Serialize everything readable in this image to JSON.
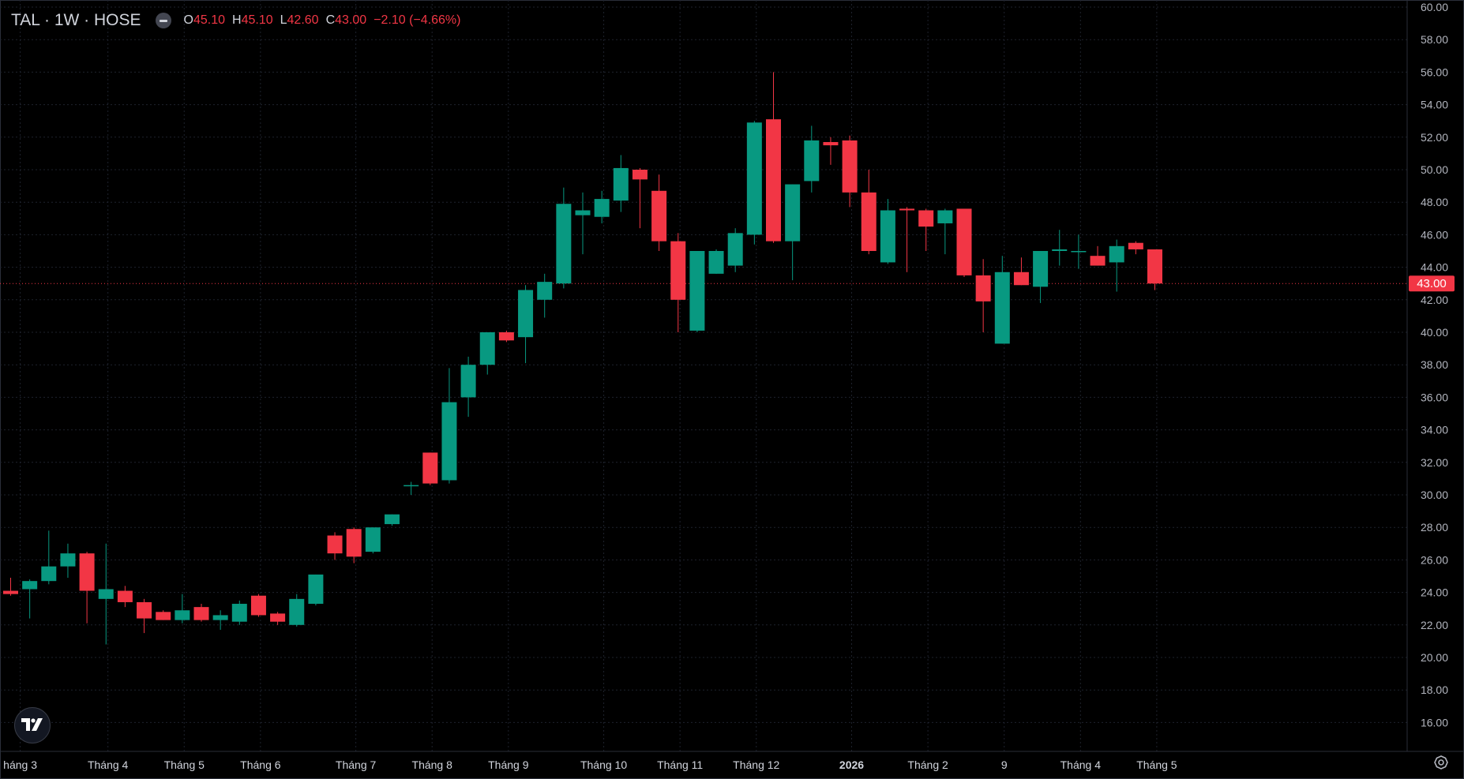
{
  "header": {
    "symbol": "TAL · 1W · HOSE",
    "open_label": "O",
    "open": "45.10",
    "high_label": "H",
    "high": "45.10",
    "low_label": "L",
    "low": "42.60",
    "close_label": "C",
    "close": "43.00",
    "change": "−2.10 (−4.66%)"
  },
  "icons": {
    "collapse": "minus-circle-icon",
    "logo": "tradingview-logo-icon",
    "settings": "gear-icon"
  },
  "colors": {
    "up": "#089981",
    "down": "#f23645",
    "background": "#000000",
    "grid": "#1e222d",
    "axis_text": "#b2b5be"
  },
  "chart_data": {
    "type": "candlestick",
    "interval": "1W",
    "last_price_label": "43.00",
    "ylim": [
      15,
      60
    ],
    "y_ticks": [
      "16.00",
      "18.00",
      "20.00",
      "22.00",
      "24.00",
      "26.00",
      "28.00",
      "30.00",
      "32.00",
      "34.00",
      "36.00",
      "38.00",
      "40.00",
      "42.00",
      "44.00",
      "46.00",
      "48.00",
      "50.00",
      "52.00",
      "54.00",
      "56.00",
      "58.00",
      "60.00"
    ],
    "x_labels": [
      {
        "i": 0.5,
        "label": "háng 3",
        "bold": false
      },
      {
        "i": 5.1,
        "label": "Tháng 4",
        "bold": false
      },
      {
        "i": 9.1,
        "label": "Tháng 5",
        "bold": false
      },
      {
        "i": 13.1,
        "label": "Tháng 6",
        "bold": false
      },
      {
        "i": 18.1,
        "label": "Tháng 7",
        "bold": false
      },
      {
        "i": 22.1,
        "label": "Tháng 8",
        "bold": false
      },
      {
        "i": 26.1,
        "label": "Tháng 9",
        "bold": false
      },
      {
        "i": 31.1,
        "label": "Tháng 10",
        "bold": false
      },
      {
        "i": 35.1,
        "label": "Tháng 11",
        "bold": false
      },
      {
        "i": 39.1,
        "label": "Tháng 12",
        "bold": false
      },
      {
        "i": 44.1,
        "label": "2026",
        "bold": true
      },
      {
        "i": 48.1,
        "label": "Tháng 2",
        "bold": false
      },
      {
        "i": 52.1,
        "label": "9",
        "bold": false
      },
      {
        "i": 56.1,
        "label": "Tháng 4",
        "bold": false
      },
      {
        "i": 60.1,
        "label": "Tháng 5",
        "bold": false
      }
    ],
    "candles": [
      [
        24.1,
        24.9,
        23.8,
        23.9
      ],
      [
        24.2,
        24.8,
        22.4,
        24.7
      ],
      [
        24.7,
        27.8,
        24.5,
        25.6
      ],
      [
        25.6,
        27.0,
        24.9,
        26.4
      ],
      [
        26.4,
        26.5,
        22.1,
        24.1
      ],
      [
        23.6,
        27.0,
        20.8,
        24.2
      ],
      [
        24.1,
        24.4,
        23.1,
        23.4
      ],
      [
        23.4,
        23.6,
        21.5,
        22.4
      ],
      [
        22.8,
        22.9,
        22.3,
        22.3
      ],
      [
        22.3,
        23.9,
        22.1,
        22.9
      ],
      [
        23.1,
        23.3,
        22.2,
        22.3
      ],
      [
        22.3,
        22.9,
        21.7,
        22.6
      ],
      [
        22.2,
        23.5,
        22.0,
        23.3
      ],
      [
        23.8,
        23.9,
        22.5,
        22.6
      ],
      [
        22.7,
        22.8,
        22.0,
        22.2
      ],
      [
        22.0,
        23.9,
        21.9,
        23.6
      ],
      [
        23.3,
        25.1,
        23.2,
        25.1
      ],
      [
        27.5,
        27.7,
        26.0,
        26.4
      ],
      [
        27.9,
        28.0,
        25.8,
        26.2
      ],
      [
        26.5,
        28.0,
        26.4,
        28.0
      ],
      [
        28.2,
        28.8,
        28.1,
        28.8
      ],
      [
        30.6,
        30.8,
        30.0,
        30.6
      ],
      [
        32.6,
        32.6,
        30.6,
        30.7
      ],
      [
        30.9,
        37.8,
        30.7,
        35.7
      ],
      [
        36.0,
        38.5,
        34.8,
        38.0
      ],
      [
        38.0,
        39.3,
        37.4,
        40.0
      ],
      [
        40.0,
        40.1,
        39.4,
        39.5
      ],
      [
        39.7,
        42.9,
        38.1,
        42.6
      ],
      [
        42.0,
        43.6,
        40.9,
        43.1
      ],
      [
        43.0,
        48.9,
        42.7,
        47.9
      ],
      [
        47.2,
        48.6,
        44.8,
        47.5
      ],
      [
        47.1,
        48.7,
        46.7,
        48.2
      ],
      [
        48.1,
        50.9,
        47.4,
        50.1
      ],
      [
        50.0,
        50.1,
        46.4,
        49.4
      ],
      [
        48.7,
        49.7,
        45.0,
        45.6
      ],
      [
        45.6,
        46.1,
        40.0,
        42.0
      ],
      [
        40.1,
        45.0,
        40.0,
        45.0
      ],
      [
        43.6,
        45.1,
        43.6,
        45.0
      ],
      [
        44.1,
        46.4,
        43.7,
        46.1
      ],
      [
        46.0,
        53.0,
        45.4,
        52.9
      ],
      [
        53.1,
        56.0,
        45.5,
        45.6
      ],
      [
        45.6,
        49.1,
        43.2,
        49.1
      ],
      [
        49.3,
        52.7,
        48.6,
        51.8
      ],
      [
        51.7,
        52.0,
        50.3,
        51.5
      ],
      [
        51.8,
        52.1,
        47.7,
        48.6
      ],
      [
        48.6,
        50.0,
        44.8,
        45.0
      ],
      [
        44.3,
        48.2,
        44.2,
        47.5
      ],
      [
        47.6,
        47.7,
        43.7,
        47.5
      ],
      [
        47.5,
        47.6,
        45.0,
        46.5
      ],
      [
        46.7,
        47.6,
        44.8,
        47.5
      ],
      [
        47.6,
        47.6,
        43.4,
        43.5
      ],
      [
        43.5,
        44.5,
        40.0,
        41.9
      ],
      [
        39.3,
        44.7,
        39.3,
        43.7
      ],
      [
        43.7,
        44.6,
        42.9,
        42.9
      ],
      [
        42.8,
        45.0,
        41.8,
        45.0
      ],
      [
        45.0,
        46.3,
        44.1,
        45.1
      ],
      [
        45.0,
        46.0,
        43.9,
        45.0
      ],
      [
        44.7,
        45.3,
        44.1,
        44.1
      ],
      [
        44.3,
        45.7,
        42.5,
        45.3
      ],
      [
        45.5,
        45.6,
        44.8,
        45.1
      ],
      [
        45.1,
        45.1,
        42.6,
        43.0
      ]
    ]
  }
}
